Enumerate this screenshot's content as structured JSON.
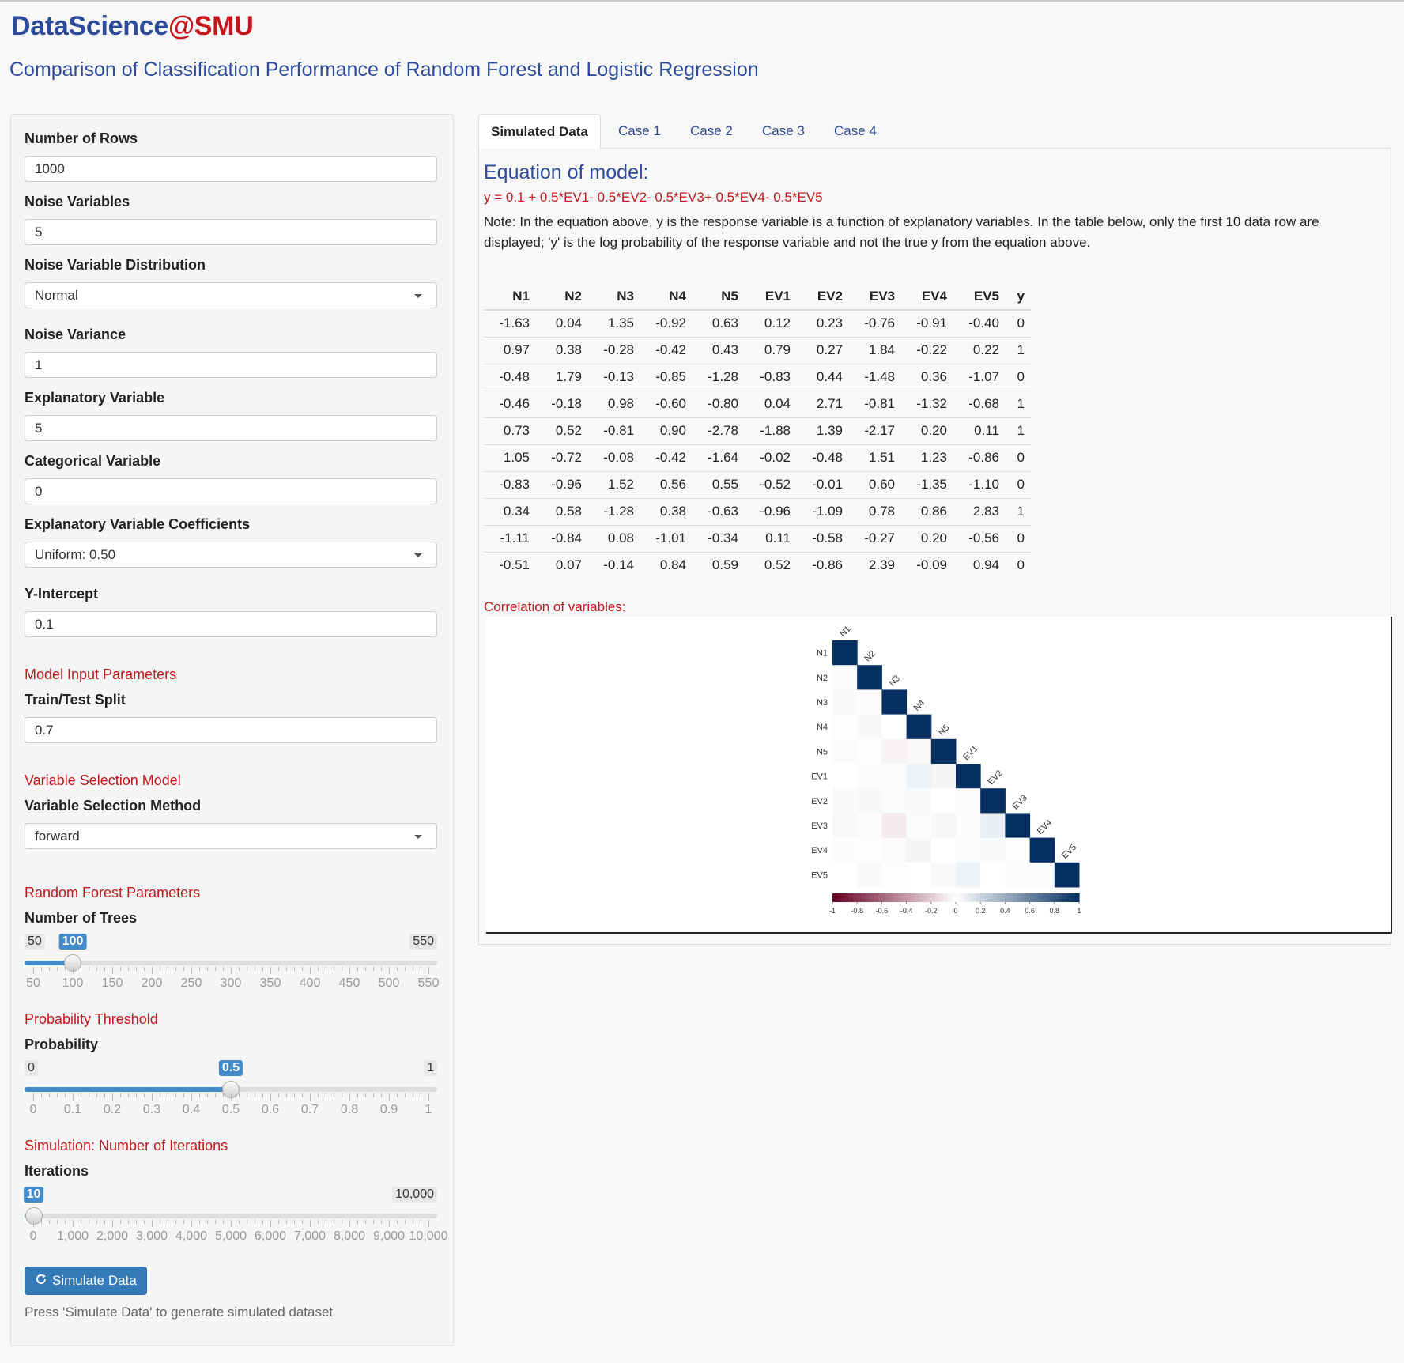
{
  "app": {
    "brand_main": "DataScience",
    "brand_at": "@SMU",
    "subtitle": "Comparison of Classification Performance of Random Forest and Logistic Regression"
  },
  "sidebar": {
    "rows_label": "Number of Rows",
    "rows_value": "1000",
    "noise_label": "Noise Variables",
    "noise_value": "5",
    "noise_dist_label": "Noise Variable Distribution",
    "noise_dist_value": "Normal",
    "noise_var_label": "Noise Variance",
    "noise_var_value": "1",
    "expl_label": "Explanatory Variable",
    "expl_value": "5",
    "cat_label": "Categorical Variable",
    "cat_value": "0",
    "coef_label": "Explanatory Variable Coefficients",
    "coef_value": "Uniform: 0.50",
    "yint_label": "Y-Intercept",
    "yint_value": "0.1",
    "model_section": "Model Input Parameters",
    "split_label": "Train/Test Split",
    "split_value": "0.7",
    "varsel_section": "Variable Selection Model",
    "varsel_label": "Variable Selection Method",
    "varsel_value": "forward",
    "rf_section": "Random Forest Parameters",
    "prob_section": "Probability Threshold",
    "sim_section": "Simulation: Number of Iterations",
    "simulate_button": "Simulate Data",
    "simulate_help": "Press 'Simulate Data' to generate simulated dataset"
  },
  "sliders": {
    "trees": {
      "label": "Number of Trees",
      "min": "50",
      "max": "550",
      "value": "100",
      "fraction": 0.1,
      "ticks": [
        "50",
        "100",
        "150",
        "200",
        "250",
        "300",
        "350",
        "400",
        "450",
        "500",
        "550"
      ]
    },
    "prob": {
      "label": "Probability",
      "min": "0",
      "max": "1",
      "value": "0.5",
      "fraction": 0.5,
      "ticks": [
        "0",
        "0.1",
        "0.2",
        "0.3",
        "0.4",
        "0.5",
        "0.6",
        "0.7",
        "0.8",
        "0.9",
        "1"
      ]
    },
    "iter": {
      "label": "Iterations",
      "min": "0",
      "max": "10,000",
      "value": "10",
      "fraction": 0.001,
      "ticks": [
        "0",
        "1,000",
        "2,000",
        "3,000",
        "4,000",
        "5,000",
        "6,000",
        "7,000",
        "8,000",
        "9,000",
        "10,000"
      ]
    }
  },
  "tabs": [
    "Simulated Data",
    "Case 1",
    "Case 2",
    "Case 3",
    "Case 4"
  ],
  "main": {
    "equation_title": "Equation of model:",
    "equation": "y = 0.1 + 0.5*EV1- 0.5*EV2- 0.5*EV3+ 0.5*EV4- 0.5*EV5",
    "note": "Note: In the equation above, y is the response variable is a function of explanatory variables. In the table below, only the first 10 data row are displayed; 'y' is the log probability of the response variable and not the true y from the equation above.",
    "corr_title": "Correlation of variables:"
  },
  "table": {
    "headers": [
      "N1",
      "N2",
      "N3",
      "N4",
      "N5",
      "EV1",
      "EV2",
      "EV3",
      "EV4",
      "EV5",
      "y"
    ],
    "rows": [
      [
        "-1.63",
        "0.04",
        "1.35",
        "-0.92",
        "0.63",
        "0.12",
        "0.23",
        "-0.76",
        "-0.91",
        "-0.40",
        "0"
      ],
      [
        "0.97",
        "0.38",
        "-0.28",
        "-0.42",
        "0.43",
        "0.79",
        "0.27",
        "1.84",
        "-0.22",
        "0.22",
        "1"
      ],
      [
        "-0.48",
        "1.79",
        "-0.13",
        "-0.85",
        "-1.28",
        "-0.83",
        "0.44",
        "-1.48",
        "0.36",
        "-1.07",
        "0"
      ],
      [
        "-0.46",
        "-0.18",
        "0.98",
        "-0.60",
        "-0.80",
        "0.04",
        "2.71",
        "-0.81",
        "-1.32",
        "-0.68",
        "1"
      ],
      [
        "0.73",
        "0.52",
        "-0.81",
        "0.90",
        "-2.78",
        "-1.88",
        "1.39",
        "-2.17",
        "0.20",
        "0.11",
        "1"
      ],
      [
        "1.05",
        "-0.72",
        "-0.08",
        "-0.42",
        "-1.64",
        "-0.02",
        "-0.48",
        "1.51",
        "1.23",
        "-0.86",
        "0"
      ],
      [
        "-0.83",
        "-0.96",
        "1.52",
        "0.56",
        "0.55",
        "-0.52",
        "-0.01",
        "0.60",
        "-1.35",
        "-1.10",
        "0"
      ],
      [
        "0.34",
        "0.58",
        "-1.28",
        "0.38",
        "-0.63",
        "-0.96",
        "-1.09",
        "0.78",
        "0.86",
        "2.83",
        "1"
      ],
      [
        "-1.11",
        "-0.84",
        "0.08",
        "-1.01",
        "-0.34",
        "0.11",
        "-0.58",
        "-0.27",
        "0.20",
        "-0.56",
        "0"
      ],
      [
        "-0.51",
        "0.07",
        "-0.14",
        "0.84",
        "0.59",
        "0.52",
        "-0.86",
        "2.39",
        "-0.09",
        "0.94",
        "0"
      ]
    ]
  },
  "chart_data": {
    "type": "heatmap",
    "title": "",
    "variables": [
      "N1",
      "N2",
      "N3",
      "N4",
      "N5",
      "EV1",
      "EV2",
      "EV3",
      "EV4",
      "EV5"
    ],
    "matrix_lower": [
      [
        1
      ],
      [
        0.02,
        1
      ],
      [
        0.03,
        -0.01,
        1
      ],
      [
        0.01,
        0.04,
        0.0,
        1
      ],
      [
        -0.02,
        0.01,
        -0.05,
        -0.03,
        1
      ],
      [
        0.0,
        -0.02,
        0.02,
        0.06,
        0.05,
        1
      ],
      [
        0.03,
        0.04,
        0.02,
        0.03,
        0.0,
        0.02,
        1
      ],
      [
        -0.03,
        -0.02,
        -0.08,
        0.02,
        0.04,
        -0.01,
        0.08,
        1
      ],
      [
        -0.01,
        0.01,
        -0.02,
        0.05,
        0.0,
        0.02,
        0.03,
        0.01,
        1
      ],
      [
        0.0,
        -0.03,
        0.01,
        0.0,
        0.03,
        0.06,
        0.0,
        -0.02,
        0.02,
        1
      ]
    ],
    "colorbar_ticks": [
      "-1",
      "-0.8",
      "-0.6",
      "-0.4",
      "-0.2",
      "0",
      "0.2",
      "0.4",
      "0.6",
      "0.8",
      "1"
    ],
    "color_low": "#67001f",
    "color_mid": "#ffffff",
    "color_high": "#053061"
  }
}
